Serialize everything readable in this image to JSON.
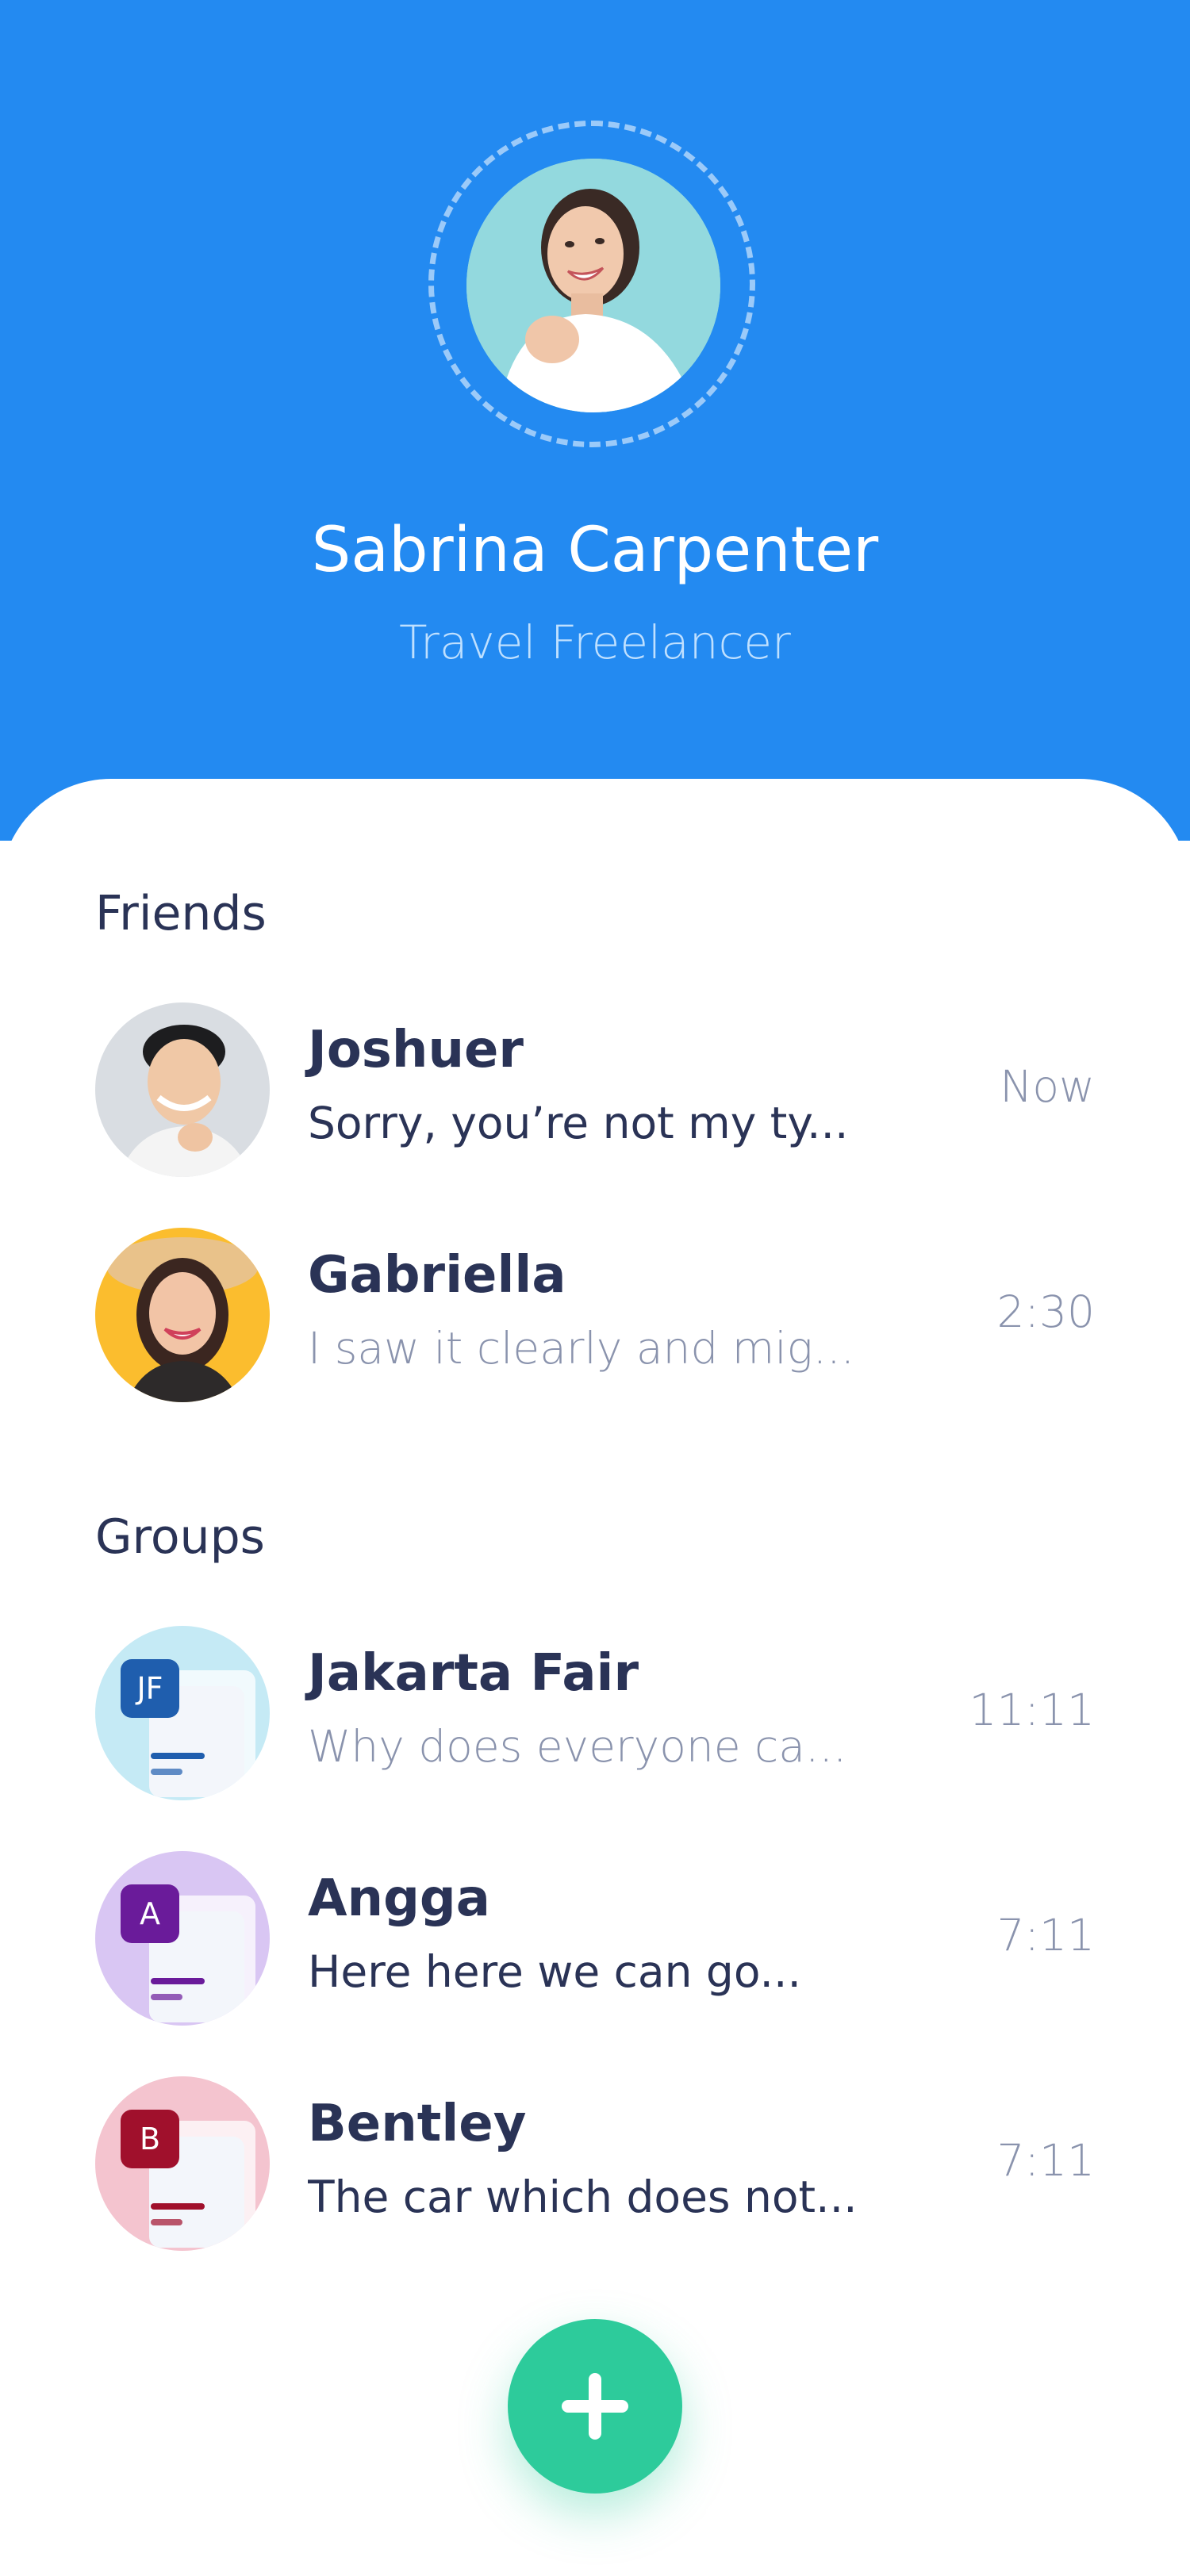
{
  "profile": {
    "name": "Sabrina Carpenter",
    "role": "Travel Freelancer",
    "avatar_icon": "profile-photo"
  },
  "colors": {
    "header": "#238af1",
    "accent": "#2dcb9b",
    "text_primary": "#2a3356",
    "text_secondary": "#8a93ad"
  },
  "friends": {
    "title": "Friends",
    "items": [
      {
        "name": "Joshuer",
        "preview": "Sorry, you’re not my ty...",
        "time": "Now"
      },
      {
        "name": "Gabriella",
        "preview": "I saw it clearly and mig...",
        "time": "2:30"
      }
    ]
  },
  "groups": {
    "title": "Groups",
    "items": [
      {
        "name": "Jakarta Fair",
        "preview": "Why does everyone ca...",
        "time": "11:11",
        "badge": "JF",
        "badge_color": "#1f5eae",
        "bg_color": "#c5eaf5"
      },
      {
        "name": "Angga",
        "preview": "Here here we can go...",
        "time": "7:11",
        "badge": "A",
        "badge_color": "#6a1b9a",
        "bg_color": "#d9c6f3"
      },
      {
        "name": "Bentley",
        "preview": "The car which does not...",
        "time": "7:11",
        "badge": "B",
        "badge_color": "#a0102c",
        "bg_color": "#f4c4cf"
      }
    ]
  },
  "fab": {
    "icon": "plus-icon"
  }
}
